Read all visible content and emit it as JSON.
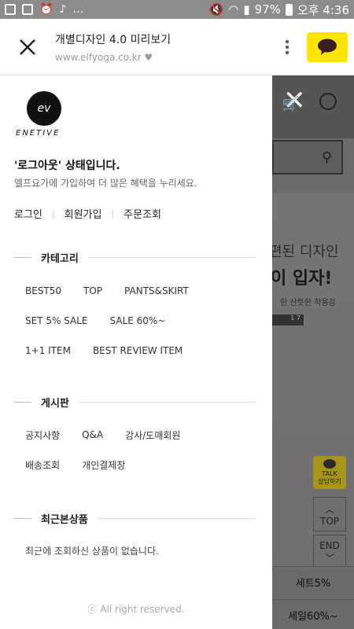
{
  "status_bar": {
    "battery": "97%",
    "time": "오후 4:36"
  },
  "browser": {
    "title": "개별디자인 4.0 미리보기",
    "url": "www.elfyoga.co.kr"
  },
  "drawer": {
    "logo_text": "ENETIVE",
    "status_title": "'로그아웃' 상태입니다.",
    "status_sub": "엘프요가에 가입하여 더 많은 혜택을 누리세요.",
    "links": [
      "로그인",
      "회원가입",
      "주문조회"
    ],
    "category": {
      "title": "카테고리",
      "rows": [
        [
          "BEST50",
          "TOP",
          "PANTS&SKIRT"
        ],
        [
          "SET 5% SALE",
          "SALE 60%~"
        ],
        [
          "1+1 ITEM",
          "BEST REVIEW ITEM"
        ]
      ]
    },
    "board": {
      "title": "게시판",
      "rows": [
        [
          "공지사항",
          "Q&A",
          "강사/도매회원"
        ],
        [
          "배송조회",
          "개인결제창"
        ]
      ]
    },
    "recent": {
      "title": "최근본상품",
      "empty": "최근에 조회하신 상품이 없습니다."
    },
    "copyright": "ⓒ All right reserved."
  },
  "background_page": {
    "hero_line1": "편된 디자인",
    "hero_line2": "이 입자!",
    "hero_line3": "한 산뜻한 착용감",
    "talk_label": "TALK",
    "talk_sub": "상담하기",
    "top_label": "TOP",
    "end_label": "END",
    "tab1": "세트5%",
    "tab2": "세일60%~"
  },
  "colors": {
    "kakao_yellow": "#fee500",
    "status_bar": "#8c8c8c"
  }
}
